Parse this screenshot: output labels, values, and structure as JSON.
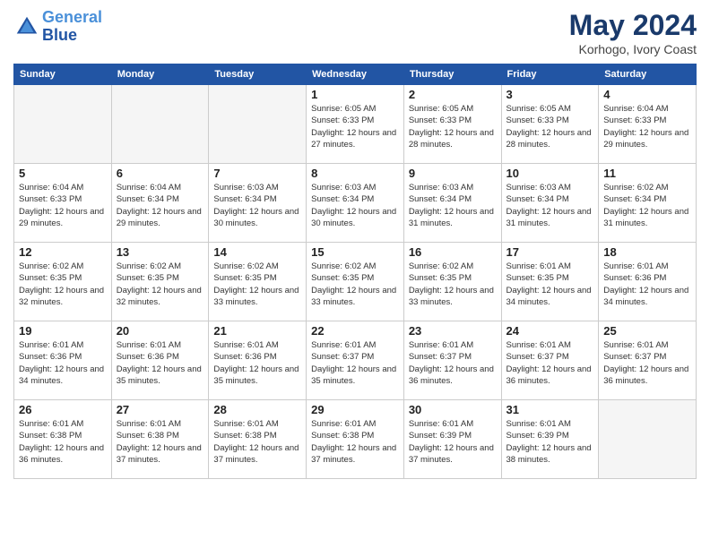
{
  "header": {
    "logo_line1": "General",
    "logo_line2": "Blue",
    "month": "May 2024",
    "location": "Korhogo, Ivory Coast"
  },
  "days_of_week": [
    "Sunday",
    "Monday",
    "Tuesday",
    "Wednesday",
    "Thursday",
    "Friday",
    "Saturday"
  ],
  "weeks": [
    [
      {
        "day": "",
        "empty": true
      },
      {
        "day": "",
        "empty": true
      },
      {
        "day": "",
        "empty": true
      },
      {
        "day": "1",
        "sunrise": "6:05 AM",
        "sunset": "6:33 PM",
        "daylight": "12 hours and 27 minutes."
      },
      {
        "day": "2",
        "sunrise": "6:05 AM",
        "sunset": "6:33 PM",
        "daylight": "12 hours and 28 minutes."
      },
      {
        "day": "3",
        "sunrise": "6:05 AM",
        "sunset": "6:33 PM",
        "daylight": "12 hours and 28 minutes."
      },
      {
        "day": "4",
        "sunrise": "6:04 AM",
        "sunset": "6:33 PM",
        "daylight": "12 hours and 29 minutes."
      }
    ],
    [
      {
        "day": "5",
        "sunrise": "6:04 AM",
        "sunset": "6:33 PM",
        "daylight": "12 hours and 29 minutes."
      },
      {
        "day": "6",
        "sunrise": "6:04 AM",
        "sunset": "6:34 PM",
        "daylight": "12 hours and 29 minutes."
      },
      {
        "day": "7",
        "sunrise": "6:03 AM",
        "sunset": "6:34 PM",
        "daylight": "12 hours and 30 minutes."
      },
      {
        "day": "8",
        "sunrise": "6:03 AM",
        "sunset": "6:34 PM",
        "daylight": "12 hours and 30 minutes."
      },
      {
        "day": "9",
        "sunrise": "6:03 AM",
        "sunset": "6:34 PM",
        "daylight": "12 hours and 31 minutes."
      },
      {
        "day": "10",
        "sunrise": "6:03 AM",
        "sunset": "6:34 PM",
        "daylight": "12 hours and 31 minutes."
      },
      {
        "day": "11",
        "sunrise": "6:02 AM",
        "sunset": "6:34 PM",
        "daylight": "12 hours and 31 minutes."
      }
    ],
    [
      {
        "day": "12",
        "sunrise": "6:02 AM",
        "sunset": "6:35 PM",
        "daylight": "12 hours and 32 minutes."
      },
      {
        "day": "13",
        "sunrise": "6:02 AM",
        "sunset": "6:35 PM",
        "daylight": "12 hours and 32 minutes."
      },
      {
        "day": "14",
        "sunrise": "6:02 AM",
        "sunset": "6:35 PM",
        "daylight": "12 hours and 33 minutes."
      },
      {
        "day": "15",
        "sunrise": "6:02 AM",
        "sunset": "6:35 PM",
        "daylight": "12 hours and 33 minutes."
      },
      {
        "day": "16",
        "sunrise": "6:02 AM",
        "sunset": "6:35 PM",
        "daylight": "12 hours and 33 minutes."
      },
      {
        "day": "17",
        "sunrise": "6:01 AM",
        "sunset": "6:35 PM",
        "daylight": "12 hours and 34 minutes."
      },
      {
        "day": "18",
        "sunrise": "6:01 AM",
        "sunset": "6:36 PM",
        "daylight": "12 hours and 34 minutes."
      }
    ],
    [
      {
        "day": "19",
        "sunrise": "6:01 AM",
        "sunset": "6:36 PM",
        "daylight": "12 hours and 34 minutes."
      },
      {
        "day": "20",
        "sunrise": "6:01 AM",
        "sunset": "6:36 PM",
        "daylight": "12 hours and 35 minutes."
      },
      {
        "day": "21",
        "sunrise": "6:01 AM",
        "sunset": "6:36 PM",
        "daylight": "12 hours and 35 minutes."
      },
      {
        "day": "22",
        "sunrise": "6:01 AM",
        "sunset": "6:37 PM",
        "daylight": "12 hours and 35 minutes."
      },
      {
        "day": "23",
        "sunrise": "6:01 AM",
        "sunset": "6:37 PM",
        "daylight": "12 hours and 36 minutes."
      },
      {
        "day": "24",
        "sunrise": "6:01 AM",
        "sunset": "6:37 PM",
        "daylight": "12 hours and 36 minutes."
      },
      {
        "day": "25",
        "sunrise": "6:01 AM",
        "sunset": "6:37 PM",
        "daylight": "12 hours and 36 minutes."
      }
    ],
    [
      {
        "day": "26",
        "sunrise": "6:01 AM",
        "sunset": "6:38 PM",
        "daylight": "12 hours and 36 minutes."
      },
      {
        "day": "27",
        "sunrise": "6:01 AM",
        "sunset": "6:38 PM",
        "daylight": "12 hours and 37 minutes."
      },
      {
        "day": "28",
        "sunrise": "6:01 AM",
        "sunset": "6:38 PM",
        "daylight": "12 hours and 37 minutes."
      },
      {
        "day": "29",
        "sunrise": "6:01 AM",
        "sunset": "6:38 PM",
        "daylight": "12 hours and 37 minutes."
      },
      {
        "day": "30",
        "sunrise": "6:01 AM",
        "sunset": "6:39 PM",
        "daylight": "12 hours and 37 minutes."
      },
      {
        "day": "31",
        "sunrise": "6:01 AM",
        "sunset": "6:39 PM",
        "daylight": "12 hours and 38 minutes."
      },
      {
        "day": "",
        "empty": true
      }
    ]
  ]
}
